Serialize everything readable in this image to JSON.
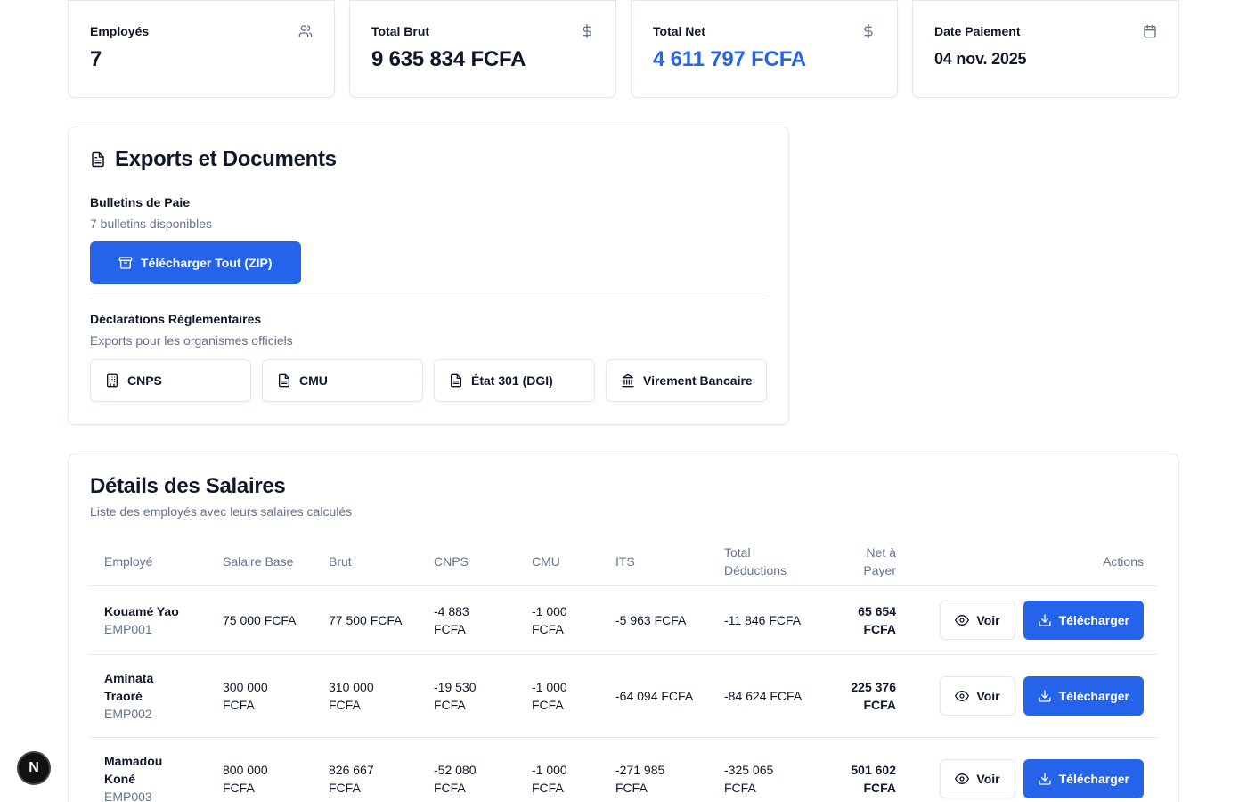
{
  "stats": [
    {
      "title": "Employés",
      "value": "7",
      "icon": "users-icon"
    },
    {
      "title": "Total Brut",
      "value": "9 635 834 FCFA",
      "icon": "dollar-icon"
    },
    {
      "title": "Total Net",
      "value": "4 611 797 FCFA",
      "icon": "dollar-icon"
    },
    {
      "title": "Date Paiement",
      "value": "04 nov. 2025",
      "icon": "calendar-icon"
    }
  ],
  "exports": {
    "title": "Exports et Documents",
    "payslips_label": "Bulletins de Paie",
    "payslips_sub": "7 bulletins disponibles",
    "download_all": "Télécharger Tout (ZIP)",
    "decl_label": "Déclarations Réglementaires",
    "decl_sub": "Exports pour les organismes officiels",
    "decl_buttons": [
      "CNPS",
      "CMU",
      "État 301 (DGI)",
      "Virement Bancaire"
    ]
  },
  "salaries": {
    "title": "Détails des Salaires",
    "subtitle": "Liste des employés avec leurs salaires calculés",
    "headers": [
      "Employé",
      "Salaire Base",
      "Brut",
      "CNPS",
      "CMU",
      "ITS",
      "Total Déductions",
      "Net à Payer",
      "Actions"
    ],
    "view_label": "Voir",
    "download_label": "Télécharger",
    "rows": [
      {
        "name": "Kouamé Yao",
        "code": "EMP001",
        "base": "75 000 FCFA",
        "brut": "77 500 FCFA",
        "cnps": "-4 883 FCFA",
        "cmu": "-1 000 FCFA",
        "its": "-5 963 FCFA",
        "ded": "-11 846 FCFA",
        "net": "65 654 FCFA"
      },
      {
        "name": "Aminata Traoré",
        "code": "EMP002",
        "base": "300 000 FCFA",
        "brut": "310 000 FCFA",
        "cnps": "-19 530 FCFA",
        "cmu": "-1 000 FCFA",
        "its": "-64 094 FCFA",
        "ded": "-84 624 FCFA",
        "net": "225 376 FCFA"
      },
      {
        "name": "Mamadou Koné",
        "code": "EMP003",
        "base": "800 000 FCFA",
        "brut": "826 667 FCFA",
        "cnps": "-52 080 FCFA",
        "cmu": "-1 000 FCFA",
        "its": "-271 985 FCFA",
        "ded": "-325 065 FCFA",
        "net": "501 602 FCFA"
      }
    ]
  },
  "badge": "N"
}
